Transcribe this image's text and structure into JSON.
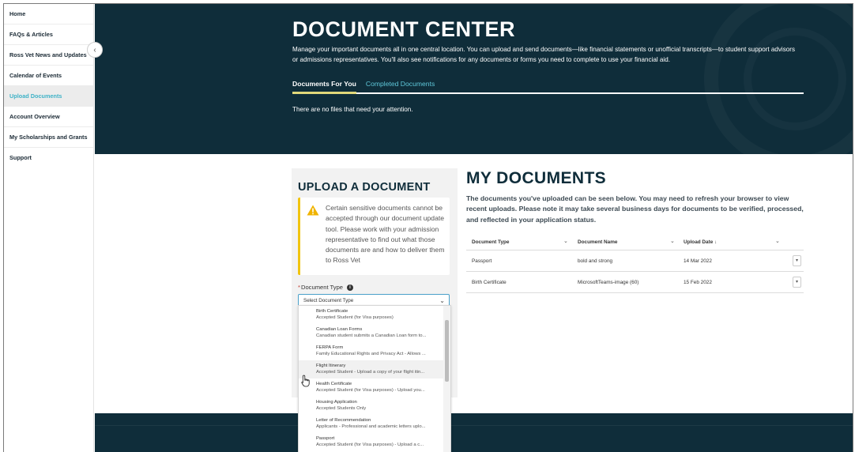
{
  "sidebar": {
    "items": [
      {
        "label": "Home"
      },
      {
        "label": "FAQs & Articles"
      },
      {
        "label": "Ross Vet News and Updates"
      },
      {
        "label": "Calendar of Events"
      },
      {
        "label": "Upload Documents"
      },
      {
        "label": "Account Overview"
      },
      {
        "label": "My Scholarships and Grants"
      },
      {
        "label": "Support"
      }
    ],
    "active_index": 4,
    "collapse_icon": "chevron-left-icon"
  },
  "hero": {
    "title": "DOCUMENT CENTER",
    "description": "Manage your important documents all in one central location. You can upload and send documents—like financial statements or unofficial transcripts—to student support advisors or admissions representatives. You'll also see notifications for any documents or forms you need to complete to use your financial aid.",
    "tabs": [
      {
        "label": "Documents For You"
      },
      {
        "label": "Completed Documents"
      }
    ],
    "empty_message": "There are no files that need your attention."
  },
  "upload": {
    "title": "UPLOAD A DOCUMENT",
    "alert_text": "Certain sensitive documents cannot be accepted through our document update tool. Please work with your admission representative to find out what those documents are and how to deliver them to Ross Vet",
    "alert_icon": "warning-icon",
    "required_mark": "*",
    "field_label": "Document Type",
    "select_value": "Select Document Type",
    "options": [
      {
        "name": "Birth Certificate",
        "desc": "Accepted Student (for Visa purposes)"
      },
      {
        "name": "Canadian Loan Forms",
        "desc": "Canadian student submits a Canadian Loan form to..."
      },
      {
        "name": "FERPA Form",
        "desc": "Family Educational Rights and Privacy Act - Allows ..."
      },
      {
        "name": "Flight Itinerary",
        "desc": "Accepted Student - Upload a copy of your flight itin..."
      },
      {
        "name": "Health Certificate",
        "desc": "Accepted Student (for Visa purposes) - Upload you..."
      },
      {
        "name": "Housing Application",
        "desc": "Accepted Students Only"
      },
      {
        "name": "Letter of Recommendation",
        "desc": "Applicants - Professional and academic letters uplo..."
      },
      {
        "name": "Passport",
        "desc": "Accepted Student (for Visa purposes) - Upload a c..."
      }
    ],
    "hovered_index": 3
  },
  "mydocs": {
    "title": "MY DOCUMENTS",
    "description": "The documents you've uploaded can be seen below. You may need to refresh your browser to view recent uploads. Please note it may take several business days for documents to be verified, processed, and reflected in your application status.",
    "columns": [
      "Document Type",
      "Document Name",
      "Upload Date ↓"
    ],
    "rows": [
      {
        "type": "Passport",
        "name": "bold and strong",
        "date": "14 Mar 2022"
      },
      {
        "type": "Birth Certificate",
        "name": "MicrosoftTeams-image (60)",
        "date": "15 Feb 2022"
      }
    ]
  },
  "colors": {
    "navy": "#0f2d3a",
    "accent_teal": "#3fb2c7",
    "tab_underline": "#e1d87a",
    "warning": "#f1c40f"
  }
}
